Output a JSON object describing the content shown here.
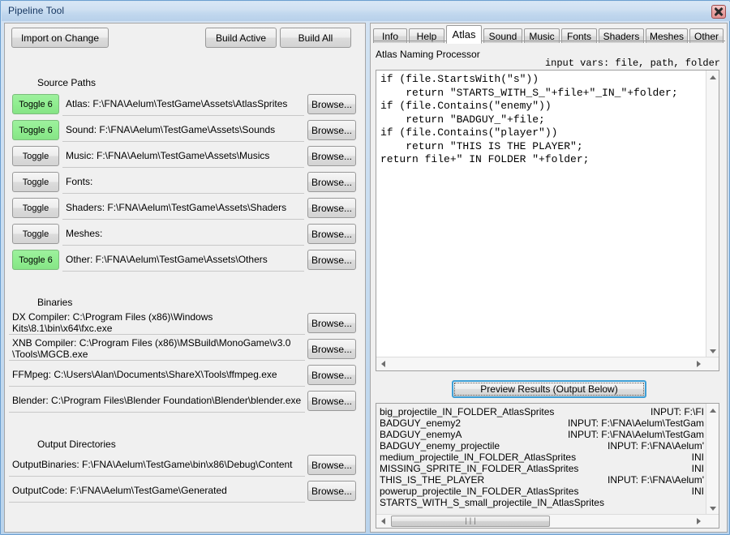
{
  "window": {
    "title": "Pipeline Tool",
    "close_label": "close-icon"
  },
  "toolbar": {
    "import_on_change": "Import on Change",
    "build_active": "Build Active",
    "build_all": "Build All"
  },
  "left": {
    "source_paths_label": "Source Paths",
    "binaries_label": "Binaries",
    "output_dirs_label": "Output Directories",
    "browse_label": "Browse...",
    "source_rows": [
      {
        "toggle": "Toggle 6",
        "on": true,
        "path": "Atlas: F:\\FNA\\Aelum\\TestGame\\Assets\\AtlasSprites"
      },
      {
        "toggle": "Toggle 6",
        "on": true,
        "path": "Sound: F:\\FNA\\Aelum\\TestGame\\Assets\\Sounds"
      },
      {
        "toggle": "Toggle",
        "on": false,
        "path": "Music: F:\\FNA\\Aelum\\TestGame\\Assets\\Musics"
      },
      {
        "toggle": "Toggle",
        "on": false,
        "path": "Fonts:"
      },
      {
        "toggle": "Toggle",
        "on": false,
        "path": "Shaders: F:\\FNA\\Aelum\\TestGame\\Assets\\Shaders"
      },
      {
        "toggle": "Toggle",
        "on": false,
        "path": "Meshes:"
      },
      {
        "toggle": "Toggle 6",
        "on": true,
        "path": "Other: F:\\FNA\\Aelum\\TestGame\\Assets\\Others"
      }
    ],
    "binaries_rows": [
      {
        "path": "DX Compiler: C:\\Program Files (x86)\\Windows Kits\\8.1\\bin\\x64\\fxc.exe",
        "lines": 1
      },
      {
        "path": "XNB Compiler: C:\\Program Files (x86)\\MSBuild\\MonoGame\\v3.0\n\\Tools\\MGCB.exe",
        "lines": 2
      },
      {
        "path": "FFMpeg: C:\\Users\\Alan\\Documents\\ShareX\\Tools\\ffmpeg.exe",
        "lines": 1
      },
      {
        "path": "Blender: C:\\Program Files\\Blender Foundation\\Blender\\blender.exe",
        "lines": 1
      }
    ],
    "output_rows": [
      {
        "path": "OutputBinaries: F:\\FNA\\Aelum\\TestGame\\bin\\x86\\Debug\\Content",
        "lines": 1
      },
      {
        "path": "OutputCode: F:\\FNA\\Aelum\\TestGame\\Generated",
        "lines": 1
      }
    ]
  },
  "right": {
    "tabs": [
      {
        "label": "Info",
        "active": false
      },
      {
        "label": "Help",
        "active": false
      },
      {
        "label": "Atlas",
        "active": true
      },
      {
        "label": "Sound",
        "active": false
      },
      {
        "label": "Music",
        "active": false
      },
      {
        "label": "Fonts",
        "active": false
      },
      {
        "label": "Shaders",
        "active": false
      },
      {
        "label": "Meshes",
        "active": false
      },
      {
        "label": "Other",
        "active": false
      }
    ],
    "processor_title": "Atlas Naming Processor",
    "input_vars": "input vars: file, path, folder",
    "code": "if (file.StartsWith(\"s\"))\n    return \"STARTS_WITH_S_\"+file+\"_IN_\"+folder;\nif (file.Contains(\"enemy\"))\n    return \"BADGUY_\"+file;\nif (file.Contains(\"player\"))\n    return \"THIS IS THE PLAYER\";\nreturn file+\" IN FOLDER \"+folder;",
    "preview_button": "Preview Results (Output Below)",
    "output_lines": [
      {
        "name": "big_projectile_IN_FOLDER_AtlasSprites",
        "input": "INPUT: F:\\FI"
      },
      {
        "name": "BADGUY_enemy2",
        "input": "INPUT: F:\\FNA\\Aelum\\TestGam"
      },
      {
        "name": "BADGUY_enemyA",
        "input": "INPUT: F:\\FNA\\Aelum\\TestGam"
      },
      {
        "name": "BADGUY_enemy_projectile",
        "input": "INPUT: F:\\FNA\\Aelum'"
      },
      {
        "name": "medium_projectile_IN_FOLDER_AtlasSprites",
        "input": "INI"
      },
      {
        "name": "MISSING_SPRITE_IN_FOLDER_AtlasSprites",
        "input": "INI"
      },
      {
        "name": "THIS_IS_THE_PLAYER",
        "input": "INPUT: F:\\FNA\\Aelum'"
      },
      {
        "name": "powerup_projectile_IN_FOLDER_AtlasSprites",
        "input": "INI"
      },
      {
        "name": "STARTS_WITH_S_small_projectile_IN_AtlasSprites",
        "input": ""
      }
    ]
  },
  "icons": {
    "scroll_up": "triangle-up-icon",
    "scroll_down": "triangle-down-icon",
    "scroll_left": "triangle-left-icon",
    "scroll_right": "triangle-right-icon",
    "grip": "|||"
  }
}
